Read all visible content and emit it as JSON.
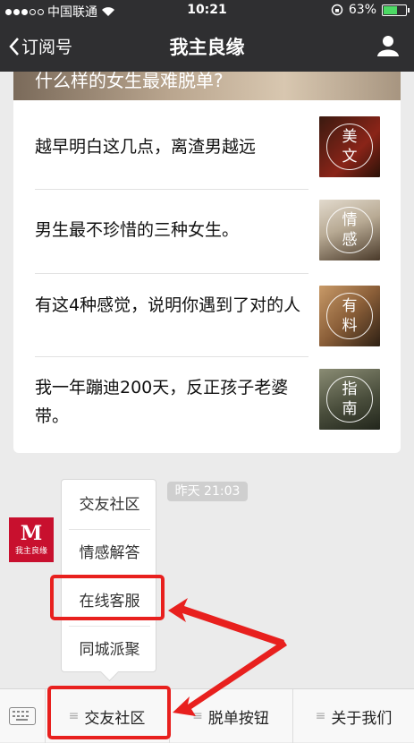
{
  "status": {
    "carrier": "中国联通",
    "time": "10:21",
    "battery": "63%"
  },
  "nav": {
    "back_label": "订阅号",
    "title": "我主良缘"
  },
  "hero_text": "什么样的女生最难脱单?",
  "articles": [
    {
      "title": "越早明白这几点，离渣男越远",
      "tag": [
        "美",
        "文"
      ],
      "thumb_colors": [
        "#3a1a10",
        "#8a2418"
      ]
    },
    {
      "title": "男生最不珍惜的三种女生。",
      "tag": [
        "情",
        "感"
      ],
      "thumb_colors": [
        "#d8cfc0",
        "#6a5a48"
      ]
    },
    {
      "title": "有这4种感觉，说明你遇到了对的人",
      "tag": [
        "有",
        "料"
      ],
      "thumb_colors": [
        "#b0855a",
        "#3a2a1a"
      ]
    },
    {
      "title": "我一年蹦迪200天，反正孩子老婆带。",
      "tag": [
        "指",
        "南"
      ],
      "thumb_colors": [
        "#6b6d5a",
        "#2a2e24"
      ]
    }
  ],
  "logo": {
    "name": "我主良缘"
  },
  "timestamp": "昨天 21:03",
  "submenu": [
    "交友社区",
    "情感解答",
    "在线客服",
    "同城派聚"
  ],
  "bottom_menu": [
    "交友社区",
    "脱单按钮",
    "关于我们"
  ],
  "colors": {
    "highlight": "#e8201e",
    "logo_bg": "#c8102e",
    "battery": "#4cd964"
  }
}
